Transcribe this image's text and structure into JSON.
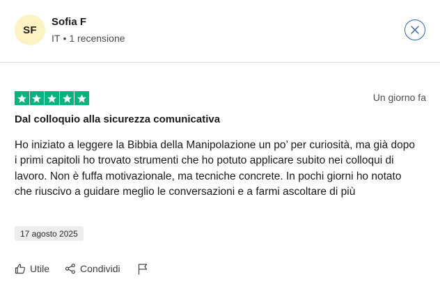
{
  "reviewer": {
    "initials": "SF",
    "name": "Sofia F",
    "country": "IT",
    "separator": "•",
    "review_count": "1 recensione",
    "avatar_color": "#fdf3c2"
  },
  "review": {
    "rating": 5,
    "max_rating": 5,
    "star_color": "#00b67a",
    "relative_date": "Un giorno fa",
    "title": "Dal colloquio alla sicurezza comunicativa",
    "body": "Ho iniziato a leggere la Bibbia della Manipolazione un po’ per curiosità, ma già dopo i primi capitoli ho trovato strumenti che ho potuto applicare subito nei colloqui di lavoro. Non è fuffa motivazionale, ma tecniche concrete. In pochi giorni ho notato che riuscivo a guidare meglio le conversazioni e a farmi ascoltare di più",
    "experience_date": "17 agosto 2025"
  },
  "actions": {
    "useful_label": "Utile",
    "share_label": "Condividi",
    "useful_icon": "thumbs-up-icon",
    "share_icon": "share-icon",
    "report_icon": "flag-icon"
  },
  "close_icon": "close-icon",
  "accent_color": "#2d5fbe"
}
